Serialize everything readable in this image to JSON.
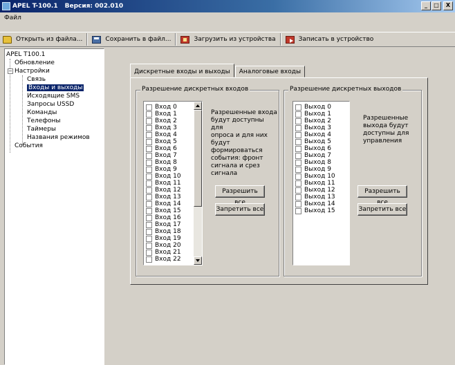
{
  "window": {
    "title": "APEL T-100.1",
    "version": "Версия: 002.010",
    "controls": {
      "minimize": "_",
      "maximize": "□",
      "close": "X"
    }
  },
  "menu": {
    "items": [
      "Файл"
    ]
  },
  "toolbar": {
    "open_label": "Открыть из файла...",
    "save_label": "Сохранить в файл...",
    "load_label": "Загрузить из устройства",
    "write_label": "Записать в устройство"
  },
  "tree": {
    "root": "APEL T100.1",
    "items": [
      {
        "label": "Обновление",
        "level": 1
      },
      {
        "label": "Настройки",
        "level": 1,
        "expander": "−"
      },
      {
        "label": "Связь",
        "level": 2
      },
      {
        "label": "Входы и выходы",
        "level": 2,
        "selected": true
      },
      {
        "label": "Исходящие SMS",
        "level": 2
      },
      {
        "label": "Запросы USSD",
        "level": 2
      },
      {
        "label": "Команды",
        "level": 2
      },
      {
        "label": "Телефоны",
        "level": 2
      },
      {
        "label": "Таймеры",
        "level": 2
      },
      {
        "label": "Названия режимов",
        "level": 2
      },
      {
        "label": "События",
        "level": 1
      }
    ]
  },
  "tabs": [
    {
      "label": "Дискретные входы и выходы",
      "active": true
    },
    {
      "label": "Аналоговые входы",
      "active": false
    }
  ],
  "inputs_group": {
    "title": "Разрешение дискретных входов",
    "items": [
      "Вход 0",
      "Вход 1",
      "Вход 2",
      "Вход 3",
      "Вход 4",
      "Вход 5",
      "Вход 6",
      "Вход 7",
      "Вход 8",
      "Вход 9",
      "Вход 10",
      "Вход 11",
      "Вход 12",
      "Вход 13",
      "Вход 14",
      "Вход 15",
      "Вход 16",
      "Вход 17",
      "Вход 18",
      "Вход 19",
      "Вход 20",
      "Вход 21",
      "Вход 22"
    ],
    "description": "Разрешенные входа\nбудут доступны для\nопроса и для них\nбудут формироваться\nсобытия: фронт\nсигнала и срез\nсигнала",
    "allow_all": "Разрешить все",
    "deny_all": "Запретить все"
  },
  "outputs_group": {
    "title": "Разрешение дискретных выходов",
    "items": [
      "Выход 0",
      "Выход 1",
      "Выход 2",
      "Выход 3",
      "Выход 4",
      "Выход 5",
      "Выход 6",
      "Выход 7",
      "Выход 8",
      "Выход 9",
      "Выход 10",
      "Выход 11",
      "Выход 12",
      "Выход 13",
      "Выход 14",
      "Выход 15"
    ],
    "description": "Разрешенные\nвыхода будут\nдоступны для\nуправления",
    "allow_all": "Разрешить все",
    "deny_all": "Запретить все"
  }
}
